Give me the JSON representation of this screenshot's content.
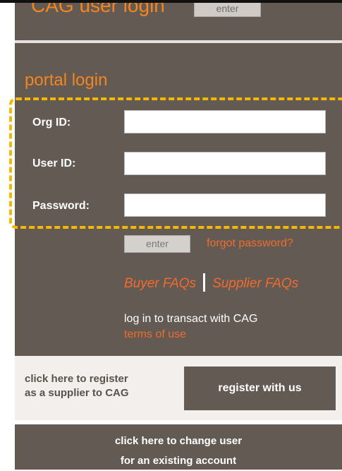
{
  "cag_login": {
    "title": "CAG user login",
    "enter_label": "enter"
  },
  "portal": {
    "title": "portal login",
    "fields": [
      {
        "label": "Org ID:",
        "value": ""
      },
      {
        "label": "User ID:",
        "value": ""
      },
      {
        "label": "Password:",
        "value": ""
      }
    ],
    "enter_label": "enter",
    "forgot_label": "forgot password?",
    "buyer_faq": "Buyer FAQs",
    "supplier_faq": "Supplier FAQs",
    "transact_text": "log in to transact with CAG",
    "terms_label": "terms of use"
  },
  "register": {
    "text_line1": "click here to register",
    "text_line2": "as a supplier to CAG",
    "button_label": "register with us"
  },
  "change_user": {
    "line1": "click here to change user",
    "line2": "for an existing account"
  },
  "colors": {
    "panel": "#625a53",
    "accent_orange": "#f5851f",
    "link_orange": "#f26b2d",
    "highlight": "#f5b700"
  }
}
